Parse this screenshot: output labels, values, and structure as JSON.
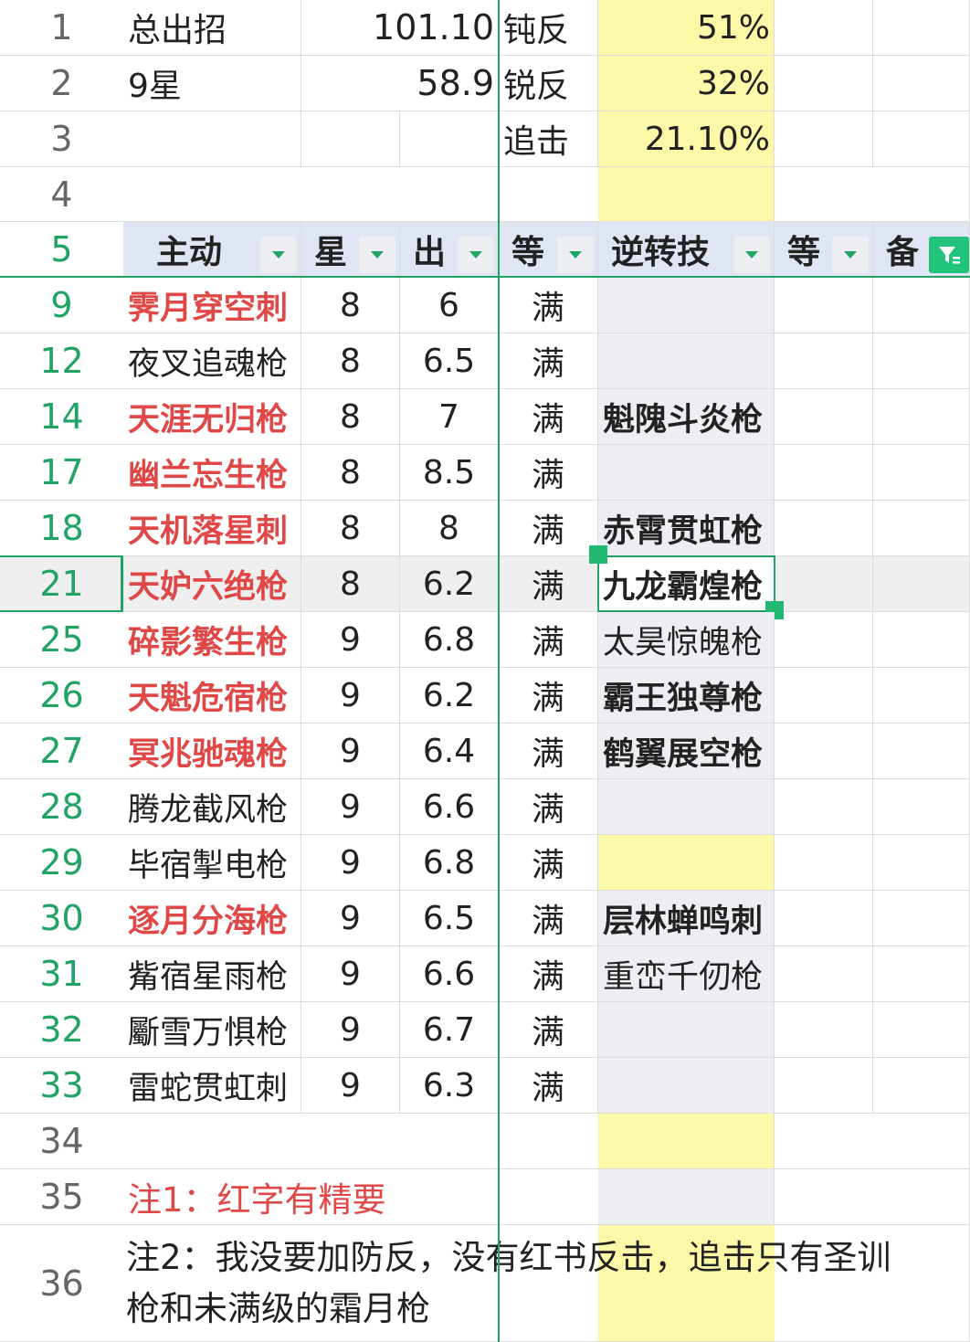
{
  "summary": {
    "r1": {
      "num": "1",
      "label": "总出招",
      "value": "101.10",
      "key": "钝反",
      "pct": "51%"
    },
    "r2": {
      "num": "2",
      "label": "9星",
      "value": "58.9",
      "key": "锐反",
      "pct": "32%"
    },
    "r3": {
      "num": "3",
      "key": "追击",
      "pct": "21.10%"
    },
    "r4": {
      "num": "4"
    }
  },
  "header": {
    "row_num": "5",
    "columns": [
      "主动",
      "星",
      "出",
      "等",
      "逆转技",
      "等",
      "备"
    ]
  },
  "rows": [
    {
      "num": "9",
      "name": "霁月穿空刺",
      "red": true,
      "star": "8",
      "out": "6",
      "level": "满",
      "skill": ""
    },
    {
      "num": "12",
      "name": "夜叉追魂枪",
      "red": false,
      "star": "8",
      "out": "6.5",
      "level": "满",
      "skill": ""
    },
    {
      "num": "14",
      "name": "天涯无归枪",
      "red": true,
      "star": "8",
      "out": "7",
      "level": "满",
      "skill": "魁隗斗炎枪"
    },
    {
      "num": "17",
      "name": "幽兰忘生枪",
      "red": true,
      "star": "8",
      "out": "8.5",
      "level": "满",
      "skill": ""
    },
    {
      "num": "18",
      "name": "天机落星刺",
      "red": true,
      "star": "8",
      "out": "8",
      "level": "满",
      "skill": "赤霄贯虹枪"
    },
    {
      "num": "21",
      "name": "天妒六绝枪",
      "red": true,
      "star": "8",
      "out": "6.2",
      "level": "满",
      "skill": "九龙霸煌枪"
    },
    {
      "num": "25",
      "name": "碎影繁生枪",
      "red": true,
      "star": "9",
      "out": "6.8",
      "level": "满",
      "skill": "太昊惊魄枪"
    },
    {
      "num": "26",
      "name": "天魁危宿枪",
      "red": true,
      "star": "9",
      "out": "6.2",
      "level": "满",
      "skill": "霸王独尊枪"
    },
    {
      "num": "27",
      "name": "冥兆驰魂枪",
      "red": true,
      "star": "9",
      "out": "6.4",
      "level": "满",
      "skill": "鹤翼展空枪"
    },
    {
      "num": "28",
      "name": "腾龙截风枪",
      "red": false,
      "star": "9",
      "out": "6.6",
      "level": "满",
      "skill": ""
    },
    {
      "num": "29",
      "name": "毕宿掣电枪",
      "red": false,
      "star": "9",
      "out": "6.8",
      "level": "满",
      "skill": ""
    },
    {
      "num": "30",
      "name": "逐月分海枪",
      "red": true,
      "star": "9",
      "out": "6.5",
      "level": "满",
      "skill": "层林蝉鸣刺"
    },
    {
      "num": "31",
      "name": "觜宿星雨枪",
      "red": false,
      "star": "9",
      "out": "6.6",
      "level": "满",
      "skill": "重峦千仞枪"
    },
    {
      "num": "32",
      "name": "斸雪万惧枪",
      "red": false,
      "star": "9",
      "out": "6.7",
      "level": "满",
      "skill": ""
    },
    {
      "num": "33",
      "name": "雷蛇贯虹刺",
      "red": false,
      "star": "9",
      "out": "6.3",
      "level": "满",
      "skill": ""
    }
  ],
  "footer": {
    "r34": {
      "num": "34"
    },
    "r35": {
      "num": "35",
      "note": "注1：红字有精要"
    },
    "r36": {
      "num": "36",
      "note_line1": "注2：我没要加防反，没有红书反击，追击只有圣训",
      "note_line2": "枪和未满级的霜月枪"
    }
  },
  "colors": {
    "accent_green": "#21a366",
    "red_text": "#e04848",
    "yellow_fill": "#fbf8a7",
    "header_fill": "#dfe5f3"
  },
  "icons": [
    "dropdown-arrow-icon",
    "filter-active-icon",
    "selection-handle-icon"
  ]
}
